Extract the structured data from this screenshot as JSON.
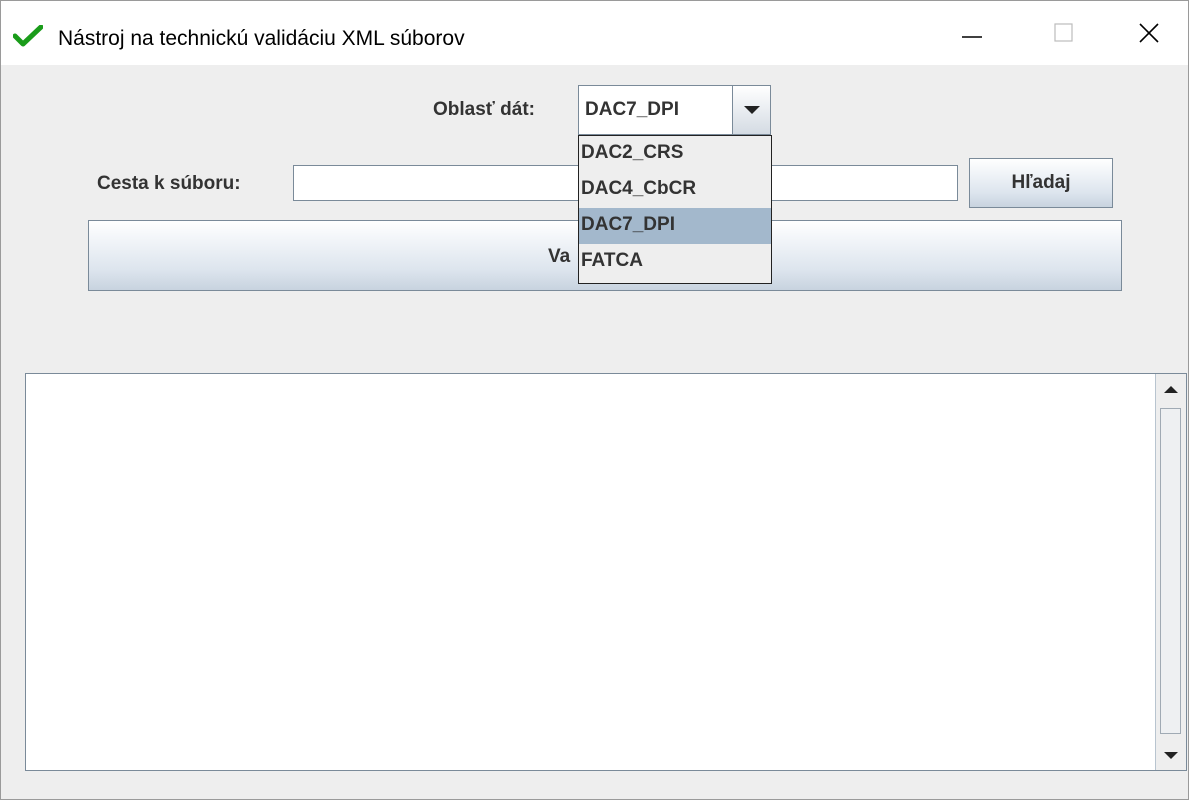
{
  "window": {
    "title": "Nástroj na technickú validáciu XML súborov",
    "icon": "check-icon",
    "accent_color": "#1a9c1a"
  },
  "form": {
    "data_area_label": "Oblasť dát:",
    "data_area_selected": "DAC7_DPI",
    "data_area_options": [
      "DAC2_CRS",
      "DAC4_CbCR",
      "DAC7_DPI",
      "FATCA"
    ],
    "file_path_label": "Cesta k súboru:",
    "file_path_value": "",
    "search_button": "Hľadaj",
    "validate_button_visible": "Va"
  },
  "output": {
    "text": ""
  }
}
